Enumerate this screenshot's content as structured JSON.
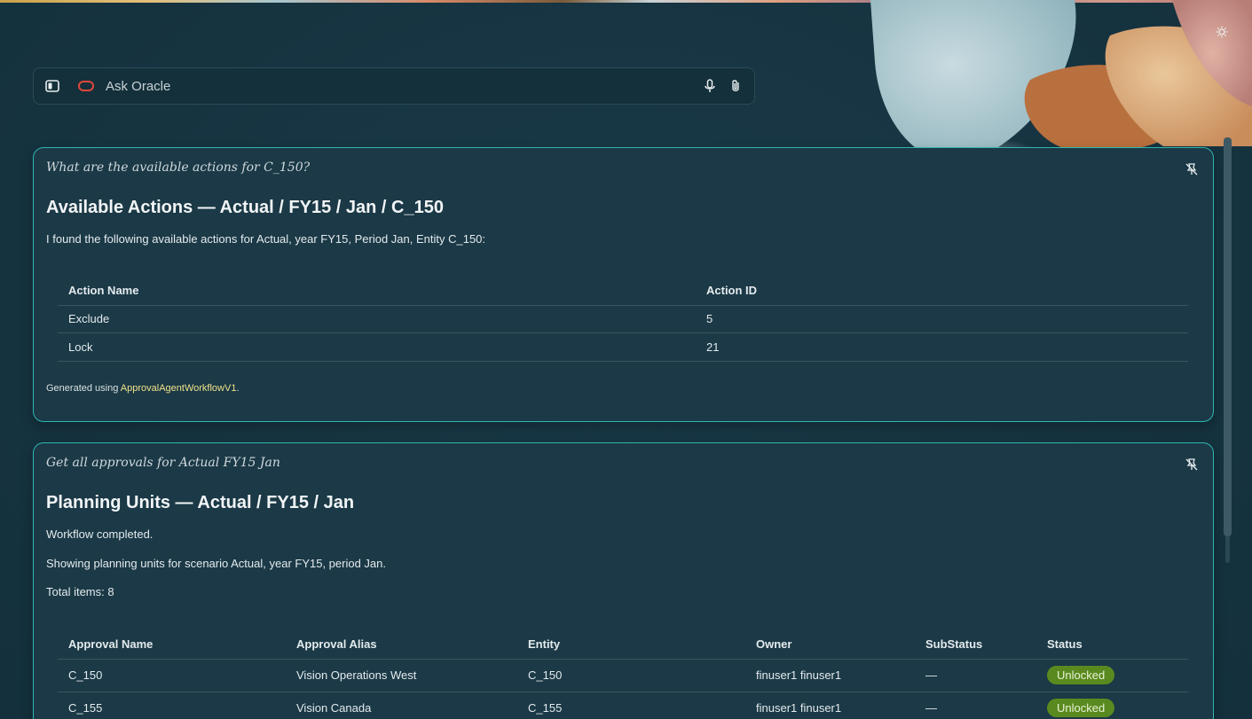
{
  "ask": {
    "placeholder": "Ask Oracle"
  },
  "cards": [
    {
      "query": "What are the available actions for C_150?",
      "title": "Available Actions — Actual / FY15 / Jan / C_150",
      "intro": "I found the following available actions for Actual, year FY15, Period Jan, Entity C_150:",
      "columns": [
        "Action Name",
        "Action ID"
      ],
      "rows": [
        {
          "name": "Exclude",
          "id": "5"
        },
        {
          "name": "Lock",
          "id": "21"
        }
      ],
      "generated_prefix": "Generated using ",
      "generated_link": "ApprovalAgentWorkflowV1",
      "generated_suffix": "."
    },
    {
      "query": "Get all approvals for Actual FY15 Jan",
      "title": "Planning Units — Actual / FY15 / Jan",
      "line1": "Workflow completed.",
      "line2": "Showing planning units for scenario Actual, year FY15, period Jan.",
      "line3": "Total items: 8",
      "columns": [
        "Approval Name",
        "Approval Alias",
        "Entity",
        "Owner",
        "SubStatus",
        "Status"
      ],
      "rows": [
        {
          "name": "C_150",
          "alias": "Vision Operations West",
          "entity": "C_150",
          "owner": "finuser1 finuser1",
          "substatus": "—",
          "status": "Unlocked"
        },
        {
          "name": "C_155",
          "alias": "Vision Canada",
          "entity": "C_155",
          "owner": "finuser1 finuser1",
          "substatus": "—",
          "status": "Unlocked"
        }
      ]
    }
  ],
  "colors": {
    "accent_border": "#2fb7b0",
    "status_green": "#5a8a1f",
    "link_yellow": "#f0e18a",
    "oracle_red": "#e0473b"
  },
  "icons": [
    "panel-toggle-icon",
    "oracle-icon",
    "mic-icon",
    "paperclip-icon",
    "pin-icon",
    "sun-icon"
  ]
}
